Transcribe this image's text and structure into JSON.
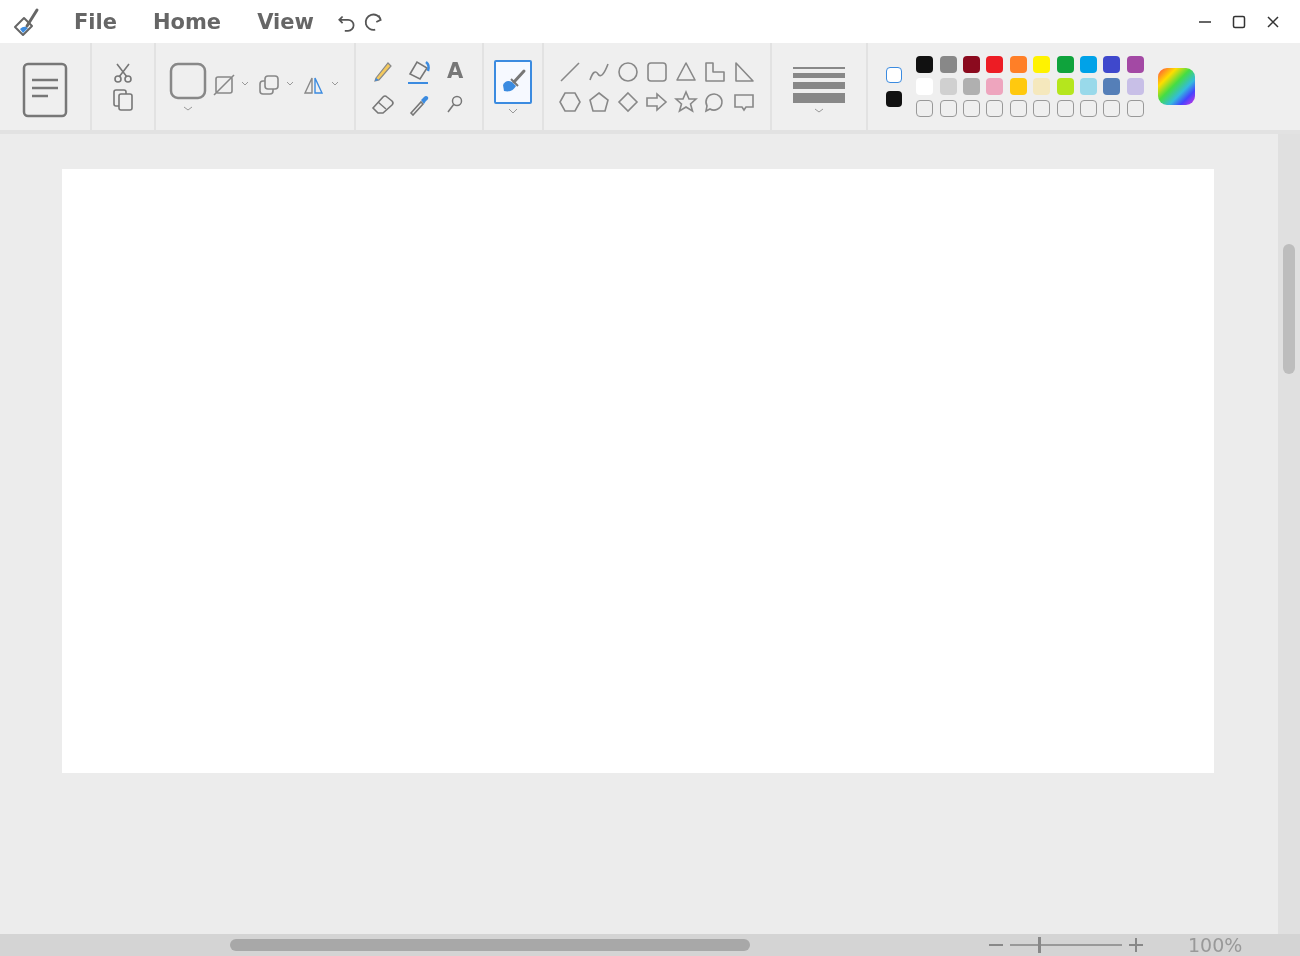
{
  "menu": [
    {
      "label": "File"
    },
    {
      "label": "Home"
    },
    {
      "label": "View"
    }
  ],
  "tools": {
    "text_glyph": "A",
    "brushes_selected": true
  },
  "colors": {
    "current": [
      {
        "color": "#ffffff",
        "selected": true
      },
      {
        "color": "#111111",
        "selected": false
      }
    ],
    "palette": [
      {
        "color": "#111111"
      },
      {
        "color": "#888888"
      },
      {
        "color": "#8b0a1e"
      },
      {
        "color": "#ed1c24"
      },
      {
        "color": "#ff7f27"
      },
      {
        "color": "#fff200"
      },
      {
        "color": "#0fa33c"
      },
      {
        "color": "#00a2e8"
      },
      {
        "color": "#3f48cc"
      },
      {
        "color": "#a349a4"
      },
      {
        "color": "#ffffff"
      },
      {
        "color": "#d0d0d0"
      },
      {
        "color": "#b0b0b0"
      },
      {
        "color": "#eea5be"
      },
      {
        "color": "#ffc90e"
      },
      {
        "color": "#f5e8bd"
      },
      {
        "color": "#b5e61d"
      },
      {
        "color": "#99d9ea"
      },
      {
        "color": "#557fb8"
      },
      {
        "color": "#c8bfe7"
      }
    ]
  },
  "zoom": {
    "level": 0.24,
    "reading": "100%"
  }
}
